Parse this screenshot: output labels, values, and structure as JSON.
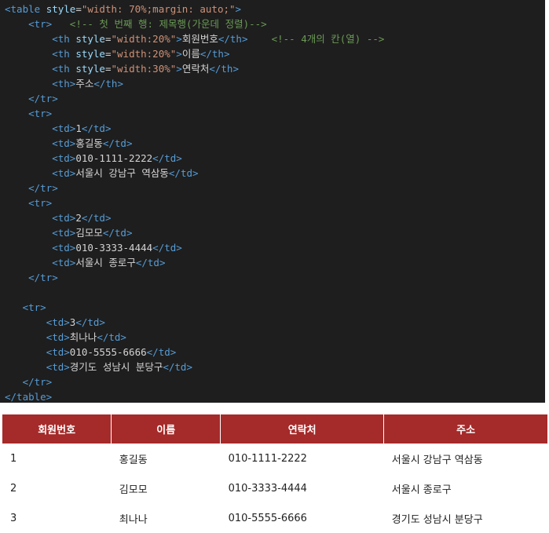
{
  "code": {
    "lines": [
      [
        {
          "c": "tag",
          "t": "<table "
        },
        {
          "c": "attr",
          "t": "style"
        },
        {
          "c": "txt",
          "t": "="
        },
        {
          "c": "str",
          "t": "\"width: 70%;margin: auto;\""
        },
        {
          "c": "tag",
          "t": ">"
        }
      ],
      [
        {
          "c": "txt",
          "t": "    "
        },
        {
          "c": "tag",
          "t": "<tr>"
        },
        {
          "c": "txt",
          "t": "   "
        },
        {
          "c": "cmt",
          "t": "<!-- 첫 번째 행: 제목행(가운데 정렬)-->"
        }
      ],
      [
        {
          "c": "txt",
          "t": "        "
        },
        {
          "c": "tag",
          "t": "<th "
        },
        {
          "c": "attr",
          "t": "style"
        },
        {
          "c": "txt",
          "t": "="
        },
        {
          "c": "str",
          "t": "\"width:20%\""
        },
        {
          "c": "tag",
          "t": ">"
        },
        {
          "c": "txt",
          "t": "회원번호"
        },
        {
          "c": "tag",
          "t": "</th>"
        },
        {
          "c": "txt",
          "t": "    "
        },
        {
          "c": "cmt",
          "t": "<!-- 4개의 칸(열) -->"
        }
      ],
      [
        {
          "c": "txt",
          "t": "        "
        },
        {
          "c": "tag",
          "t": "<th "
        },
        {
          "c": "attr",
          "t": "style"
        },
        {
          "c": "txt",
          "t": "="
        },
        {
          "c": "str",
          "t": "\"width:20%\""
        },
        {
          "c": "tag",
          "t": ">"
        },
        {
          "c": "txt",
          "t": "이름"
        },
        {
          "c": "tag",
          "t": "</th>"
        }
      ],
      [
        {
          "c": "txt",
          "t": "        "
        },
        {
          "c": "tag",
          "t": "<th "
        },
        {
          "c": "attr",
          "t": "style"
        },
        {
          "c": "txt",
          "t": "="
        },
        {
          "c": "str",
          "t": "\"width:30%\""
        },
        {
          "c": "tag",
          "t": ">"
        },
        {
          "c": "txt",
          "t": "연락처"
        },
        {
          "c": "tag",
          "t": "</th>"
        }
      ],
      [
        {
          "c": "txt",
          "t": "        "
        },
        {
          "c": "tag",
          "t": "<th>"
        },
        {
          "c": "txt",
          "t": "주소"
        },
        {
          "c": "tag",
          "t": "</th>"
        }
      ],
      [
        {
          "c": "txt",
          "t": "    "
        },
        {
          "c": "tag",
          "t": "</tr>"
        }
      ],
      [
        {
          "c": "txt",
          "t": "    "
        },
        {
          "c": "tag",
          "t": "<tr>"
        }
      ],
      [
        {
          "c": "txt",
          "t": "        "
        },
        {
          "c": "tag",
          "t": "<td>"
        },
        {
          "c": "txt",
          "t": "1"
        },
        {
          "c": "tag",
          "t": "</td>"
        }
      ],
      [
        {
          "c": "txt",
          "t": "        "
        },
        {
          "c": "tag",
          "t": "<td>"
        },
        {
          "c": "txt",
          "t": "홍길동"
        },
        {
          "c": "tag",
          "t": "</td>"
        }
      ],
      [
        {
          "c": "txt",
          "t": "        "
        },
        {
          "c": "tag",
          "t": "<td>"
        },
        {
          "c": "txt",
          "t": "010-1111-2222"
        },
        {
          "c": "tag",
          "t": "</td>"
        }
      ],
      [
        {
          "c": "txt",
          "t": "        "
        },
        {
          "c": "tag",
          "t": "<td>"
        },
        {
          "c": "txt",
          "t": "서울시 강남구 역삼동"
        },
        {
          "c": "tag",
          "t": "</td>"
        }
      ],
      [
        {
          "c": "txt",
          "t": "    "
        },
        {
          "c": "tag",
          "t": "</tr>"
        }
      ],
      [
        {
          "c": "txt",
          "t": "    "
        },
        {
          "c": "tag",
          "t": "<tr>"
        }
      ],
      [
        {
          "c": "txt",
          "t": "        "
        },
        {
          "c": "tag",
          "t": "<td>"
        },
        {
          "c": "txt",
          "t": "2"
        },
        {
          "c": "tag",
          "t": "</td>"
        }
      ],
      [
        {
          "c": "txt",
          "t": "        "
        },
        {
          "c": "tag",
          "t": "<td>"
        },
        {
          "c": "txt",
          "t": "김모모"
        },
        {
          "c": "tag",
          "t": "</td>"
        }
      ],
      [
        {
          "c": "txt",
          "t": "        "
        },
        {
          "c": "tag",
          "t": "<td>"
        },
        {
          "c": "txt",
          "t": "010-3333-4444"
        },
        {
          "c": "tag",
          "t": "</td>"
        }
      ],
      [
        {
          "c": "txt",
          "t": "        "
        },
        {
          "c": "tag",
          "t": "<td>"
        },
        {
          "c": "txt",
          "t": "서울시 종로구"
        },
        {
          "c": "tag",
          "t": "</td>"
        }
      ],
      [
        {
          "c": "txt",
          "t": "    "
        },
        {
          "c": "tag",
          "t": "</tr>"
        }
      ],
      [],
      [
        {
          "c": "txt",
          "t": "   "
        },
        {
          "c": "tag",
          "t": "<tr>"
        }
      ],
      [
        {
          "c": "txt",
          "t": "       "
        },
        {
          "c": "tag",
          "t": "<td>"
        },
        {
          "c": "txt",
          "t": "3"
        },
        {
          "c": "tag",
          "t": "</td>"
        }
      ],
      [
        {
          "c": "txt",
          "t": "       "
        },
        {
          "c": "tag",
          "t": "<td>"
        },
        {
          "c": "txt",
          "t": "최나나"
        },
        {
          "c": "tag",
          "t": "</td>"
        }
      ],
      [
        {
          "c": "txt",
          "t": "       "
        },
        {
          "c": "tag",
          "t": "<td>"
        },
        {
          "c": "txt",
          "t": "010-5555-6666"
        },
        {
          "c": "tag",
          "t": "</td>"
        }
      ],
      [
        {
          "c": "txt",
          "t": "       "
        },
        {
          "c": "tag",
          "t": "<td>"
        },
        {
          "c": "txt",
          "t": "경기도 성남시 분당구"
        },
        {
          "c": "tag",
          "t": "</td>"
        }
      ],
      [
        {
          "c": "txt",
          "t": "   "
        },
        {
          "c": "tag",
          "t": "</tr>"
        }
      ],
      [
        {
          "c": "tag",
          "t": "</table>"
        }
      ]
    ]
  },
  "colors": {
    "code_bg": "#1e1e1e",
    "tag": "#569cd6",
    "attribute": "#9cdcfe",
    "string": "#ce9178",
    "comment": "#6a9955",
    "text": "#d4d4d4",
    "header_bg": "#a52a2a",
    "header_text": "#ffffff"
  },
  "table": {
    "headers": [
      "회원번호",
      "이름",
      "연락처",
      "주소"
    ],
    "rows": [
      [
        "1",
        "홍길동",
        "010-1111-2222",
        "서울시 강남구 역삼동"
      ],
      [
        "2",
        "김모모",
        "010-3333-4444",
        "서울시 종로구"
      ],
      [
        "3",
        "최나나",
        "010-5555-6666",
        "경기도 성남시 분당구"
      ]
    ]
  }
}
